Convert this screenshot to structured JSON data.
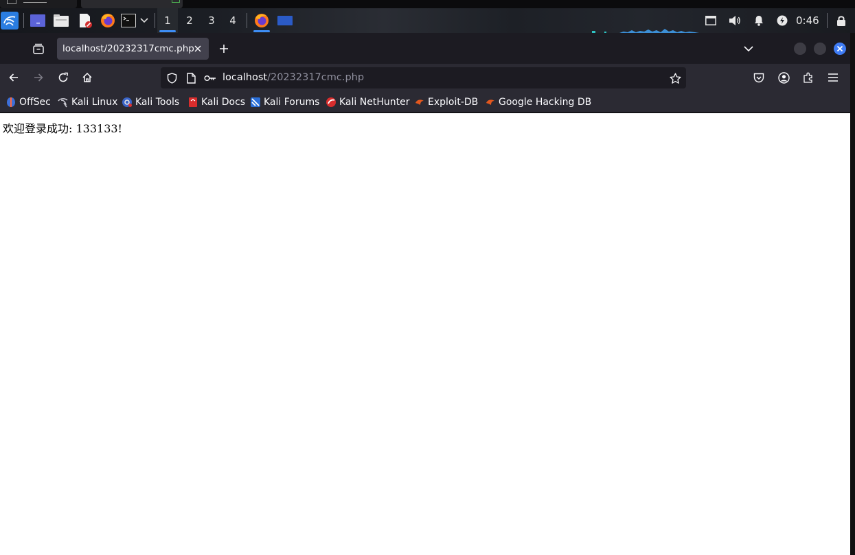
{
  "taskbar": {
    "workspaces": [
      "1",
      "2",
      "3",
      "4"
    ],
    "active_workspace_index": 0,
    "clock": "0:46",
    "launchers": [
      "kali-menu-icon",
      "show-desktop-icon",
      "file-manager-icon",
      "text-editor-icon",
      "firefox-icon",
      "terminal-icon",
      "chevron-down-icon"
    ],
    "tray": [
      "window-icon",
      "volume-icon",
      "bell-icon",
      "power-icon",
      "lock-icon"
    ],
    "accent": "#3e8ef7"
  },
  "browser": {
    "tab_title": "localhost/20232317cmc.php",
    "url_host": "localhost",
    "url_path": "/20232317cmc.php",
    "bookmarks": [
      {
        "label": "OffSec"
      },
      {
        "label": "Kali Linux"
      },
      {
        "label": "Kali Tools"
      },
      {
        "label": "Kali Docs"
      },
      {
        "label": "Kali Forums"
      },
      {
        "label": "Kali NetHunter"
      },
      {
        "label": "Exploit-DB"
      },
      {
        "label": "Google Hacking DB"
      }
    ]
  },
  "page": {
    "greeting": "欢迎登录成功: 133133!"
  }
}
